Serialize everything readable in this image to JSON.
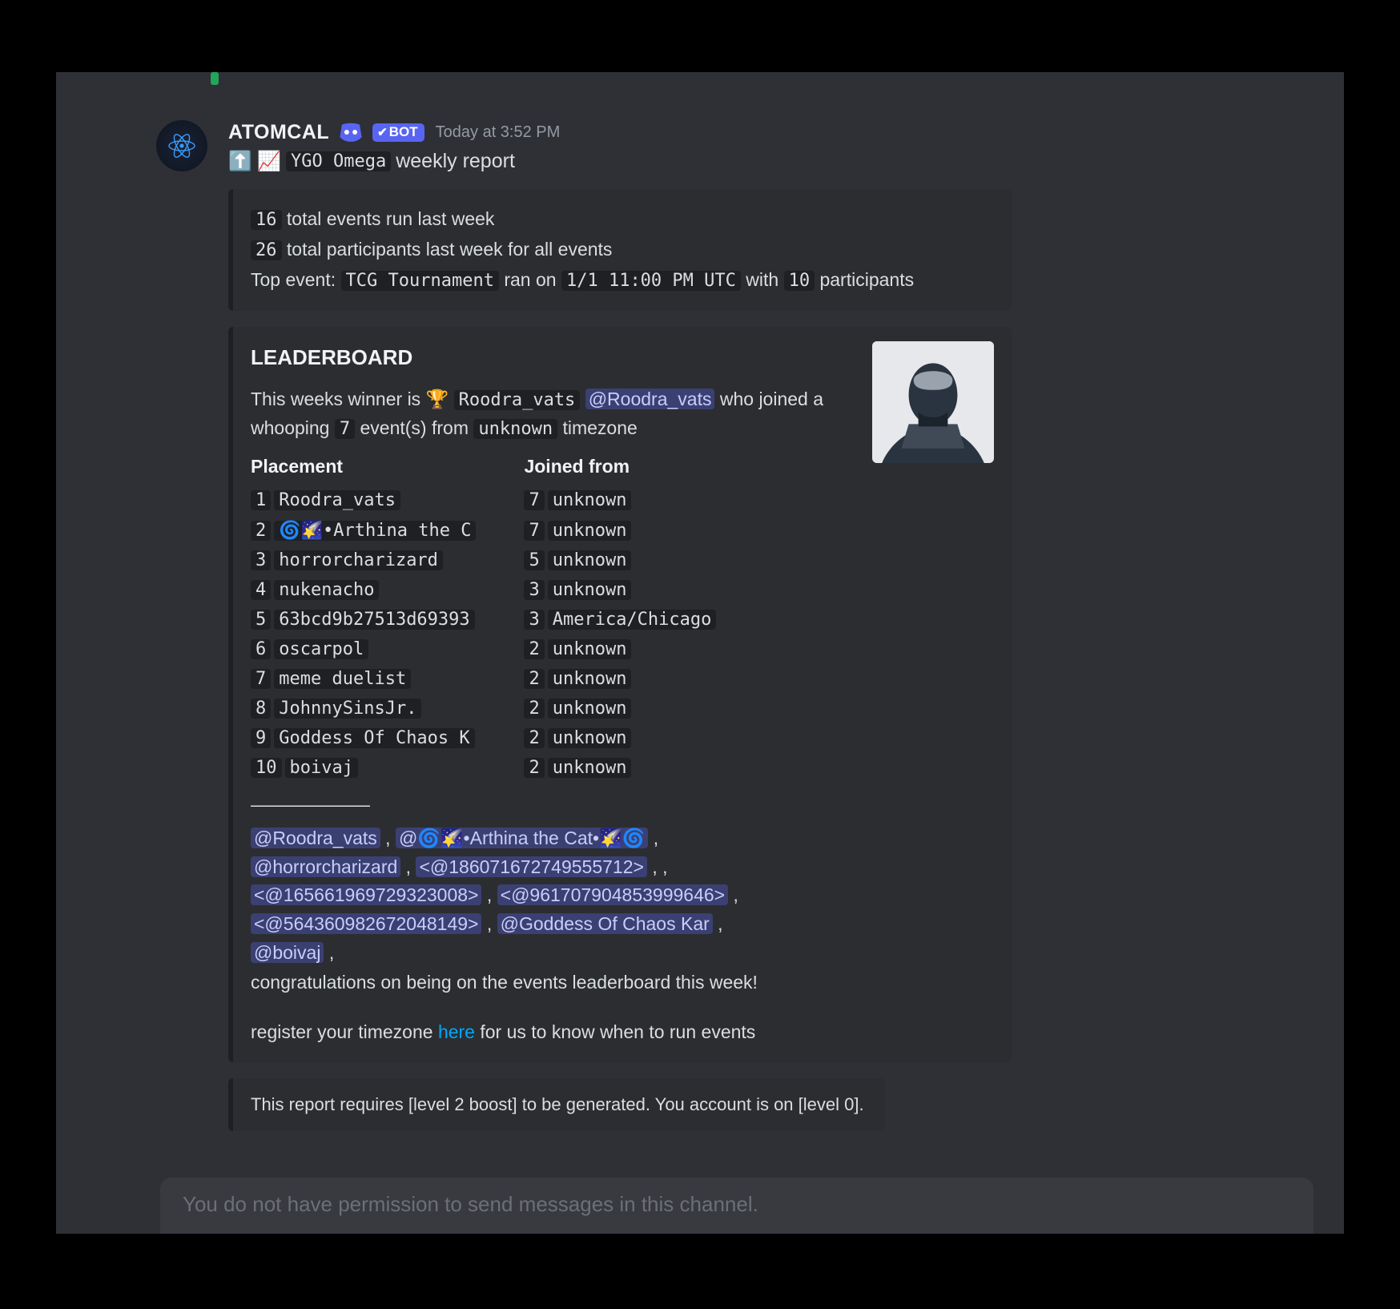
{
  "author": {
    "name": "ATOMCAL",
    "bot_tag": "BOT",
    "timestamp": "Today at 3:52 PM"
  },
  "title": {
    "emoji1": "⬆️",
    "emoji2": "📈",
    "server_code": "YGO Omega",
    "rest": "weekly report"
  },
  "summary": {
    "events_count": "16",
    "events_label": "total events run last week",
    "participants_count": "26",
    "participants_label": "total participants last week for all events",
    "top_event_label": "Top event:",
    "top_event_name": "TCG Tournament",
    "ran_on_label": "ran on",
    "top_event_time": "1/1 11:00 PM UTC",
    "with_label": "with",
    "top_event_participants": "10",
    "participants_word": "participants"
  },
  "leaderboard": {
    "heading": "LEADERBOARD",
    "winner_prefix": "This weeks winner is",
    "trophy": "🏆",
    "winner_code": "Roodra_vats",
    "winner_mention": "@Roodra_vats",
    "winner_mid": "who joined a whooping",
    "winner_events_count": "7",
    "winner_mid2": "event(s) from",
    "winner_tz": "unknown",
    "winner_tail": "timezone",
    "placement_title": "Placement",
    "joined_title": "Joined from",
    "placement": [
      {
        "n": "1",
        "name": "Roodra_vats"
      },
      {
        "n": "2",
        "name": "🌀🌠•Arthina the C"
      },
      {
        "n": "3",
        "name": "horrorcharizard"
      },
      {
        "n": "4",
        "name": "nukenacho"
      },
      {
        "n": "5",
        "name": "63bcd9b27513d69393"
      },
      {
        "n": "6",
        "name": "oscarpol"
      },
      {
        "n": "7",
        "name": "meme duelist"
      },
      {
        "n": "8",
        "name": "JohnnySinsJr."
      },
      {
        "n": "9",
        "name": "Goddess Of Chaos K"
      },
      {
        "n": "10",
        "name": "boivaj"
      }
    ],
    "joined": [
      {
        "c": "7",
        "tz": "unknown"
      },
      {
        "c": "7",
        "tz": "unknown"
      },
      {
        "c": "5",
        "tz": "unknown"
      },
      {
        "c": "3",
        "tz": "unknown"
      },
      {
        "c": "3",
        "tz": "America/Chicago"
      },
      {
        "c": "2",
        "tz": "unknown"
      },
      {
        "c": "2",
        "tz": "unknown"
      },
      {
        "c": "2",
        "tz": "unknown"
      },
      {
        "c": "2",
        "tz": "unknown"
      },
      {
        "c": "2",
        "tz": "unknown"
      }
    ],
    "dashes": "———————",
    "mentions": [
      "@Roodra_vats",
      "@🌀🌠•Arthina the Cat•🌠🌀",
      "@horrorcharizard",
      "<@186071672749555712>",
      "<@165661969729323008>",
      "<@961707904853999646>",
      "<@564360982672048149>",
      "@Goddess Of Chaos Kar",
      "@boivaj"
    ],
    "congrats": "congratulations on being on the events leaderboard this week!",
    "register_prefix": "register your timezone",
    "register_link": "here",
    "register_suffix": "for us to know when to run events"
  },
  "footer": {
    "text": "This report requires [level 2 boost] to be generated. You account is on [level 0]."
  },
  "compose": {
    "placeholder": "You do not have permission to send messages in this channel."
  }
}
